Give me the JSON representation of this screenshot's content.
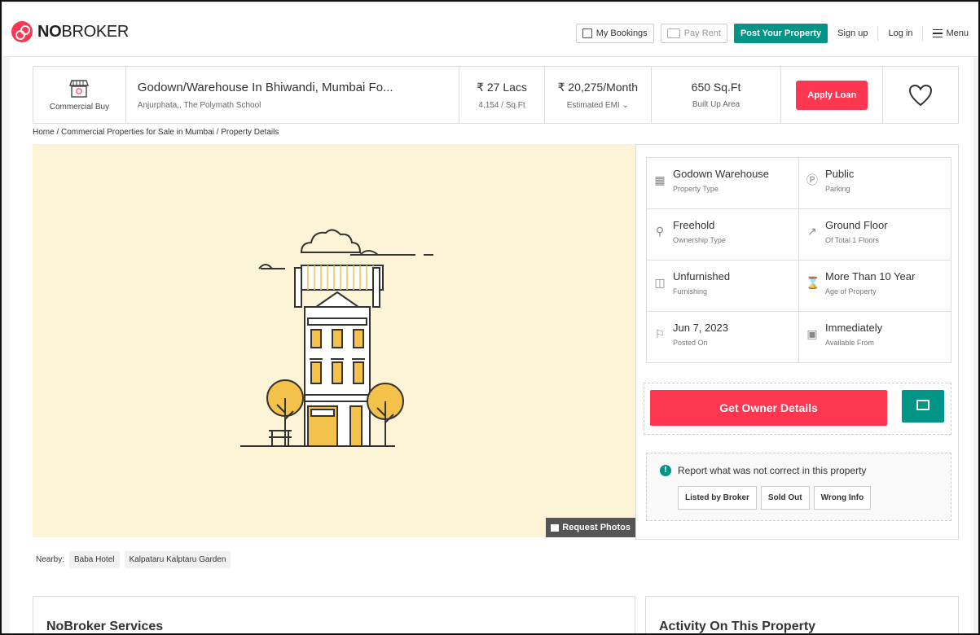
{
  "brand": {
    "logo_bold": "NO",
    "logo_rest": "BROKER"
  },
  "nav": {
    "my_bookings": "My Bookings",
    "pay_rent": "Pay Rent",
    "post_property": "Post Your Property",
    "sign_up": "Sign up",
    "log_in": "Log in",
    "menu": "Menu"
  },
  "summary": {
    "type_label": "Commercial Buy",
    "title": "Godown/Warehouse In Bhiwandi, Mumbai Fo...",
    "subtitle": "Anjurphata,, The Polymath School",
    "price": "₹ 27 Lacs",
    "price_per_sqft": "4,154 / Sq.Ft",
    "emi": "₹ 20,275/Month",
    "emi_label": "Estimated EMI",
    "area": "650 Sq.Ft",
    "area_label": "Built Up Area",
    "apply_loan": "Apply Loan"
  },
  "breadcrumb": "Home / Commercial Properties for Sale in Mumbai / Property Details",
  "photo": {
    "request_label": "Request Photos"
  },
  "nearby": {
    "label": "Nearby:",
    "items": [
      "Baba Hotel",
      "Kalpataru Kalptaru Garden"
    ]
  },
  "details": [
    {
      "value": "Godown Warehouse",
      "label": "Property Type",
      "icon": "building-icon"
    },
    {
      "value": "Public",
      "label": "Parking",
      "icon": "parking-icon"
    },
    {
      "value": "Freehold",
      "label": "Ownership Type",
      "icon": "ownership-icon"
    },
    {
      "value": "Ground Floor",
      "label": "Of Total 1 Floors",
      "icon": "stairs-icon"
    },
    {
      "value": "Unfurnished",
      "label": "Furnishing",
      "icon": "furnishing-icon"
    },
    {
      "value": "More Than 10 Year",
      "label": "Age of Property",
      "icon": "hourglass-icon"
    },
    {
      "value": "Jun 7, 2023",
      "label": "Posted On",
      "icon": "flag-icon"
    },
    {
      "value": "Immediately",
      "label": "Available From",
      "icon": "calendar-icon"
    }
  ],
  "owner": {
    "button": "Get Owner Details"
  },
  "report": {
    "text": "Report what was not correct in this property",
    "buttons": [
      "Listed by Broker",
      "Sold Out",
      "Wrong Info"
    ]
  },
  "sections": {
    "services": "NoBroker Services",
    "activity": "Activity On This Property"
  },
  "colors": {
    "brand_red": "#fd3752",
    "brand_teal": "#009587",
    "photo_bg": "#fcf4d6"
  }
}
